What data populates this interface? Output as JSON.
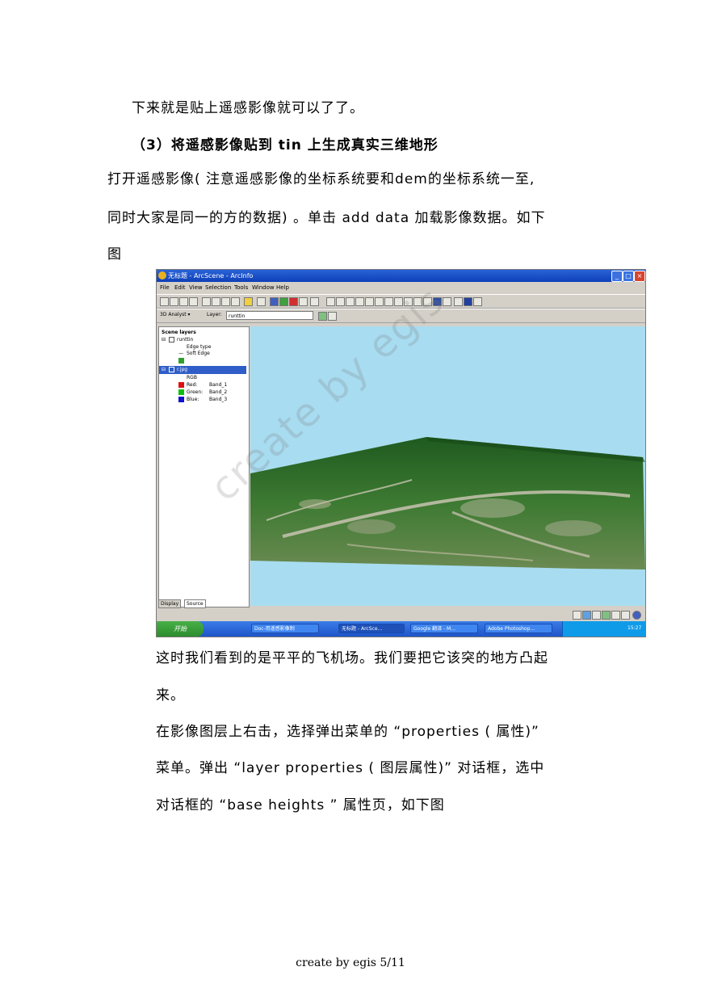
{
  "paragraphs": {
    "p1": "下来就是贴上遥感影像就可以了了。",
    "heading": "（3）将遥感影像贴到 tin 上生成真实三维地形",
    "p2_line1": "打开遥感影像(  注意遥感影像的坐标系统要和dem的坐标系统一至,",
    "p2_line2": "同时大家是同一的方的数据) 。单击 add data 加载影像数据。如下",
    "p2_line3": "图",
    "p3_line1": "这时我们看到的是平平的飞机场。我们要把它该突的地方凸起",
    "p3_line2": "来。",
    "p4_line1": "在影像图层上右击，选择弹出菜单的 “properties ( 属性)”",
    "p4_line2": "菜单。弹出 “layer properties ( 图层属性)” 对话框，选中",
    "p4_line3": "对话框的  “base heights ” 属性页，如下图"
  },
  "screenshot": {
    "window_title": "无标题 - ArcScene - ArcInfo",
    "menus": [
      "File",
      "Edit",
      "View",
      "Selection",
      "Tools",
      "Window",
      "Help"
    ],
    "analyst_label": "3D Analyst ▾",
    "layer_label": "Layer:",
    "layer_value": "runttin",
    "toc": {
      "root": "Scene layers",
      "layer1": "runttin",
      "layer1_sub1": "Edge type",
      "layer1_sub2": "Soft Edge",
      "layer2": "r.jpg",
      "layer2_sub": "RGB",
      "red": "Red:",
      "red_band": "Band_1",
      "green": "Green:",
      "green_band": "Band_2",
      "blue": "Blue:",
      "blue_band": "Band_3"
    },
    "tabs": [
      "Display",
      "Source"
    ],
    "taskbar": {
      "start": "开始",
      "tasks": [
        "Doc-用遥感影像制",
        "无标题 - ArcSce...",
        "Google 翻译 - M...",
        "Adobe Photoshop..."
      ],
      "clock": "15:27"
    },
    "colors": {
      "sky": "#a8dcf0",
      "terrain": "#2f6b2a",
      "red_swatch": "#e01010",
      "green_swatch": "#10c010",
      "blue_swatch": "#1010d0"
    }
  },
  "watermark": "create by egis",
  "footer": "create  by egis 5/11"
}
